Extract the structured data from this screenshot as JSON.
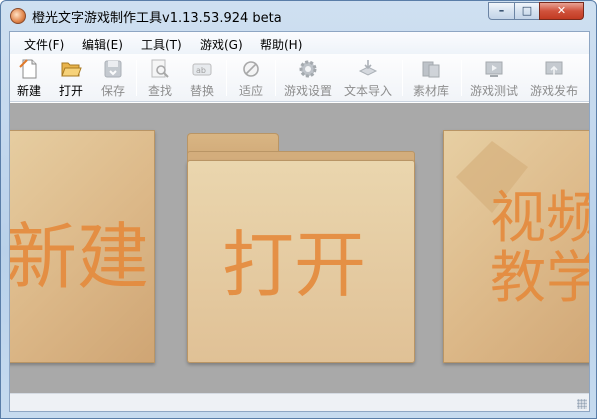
{
  "window": {
    "title": "橙光文字游戏制作工具v1.13.53.924 beta",
    "controls": {
      "minimize": "–",
      "maximize": "□",
      "close": "✕"
    }
  },
  "menu": [
    {
      "label": "文件(F)"
    },
    {
      "label": "编辑(E)"
    },
    {
      "label": "工具(T)"
    },
    {
      "label": "游戏(G)"
    },
    {
      "label": "帮助(H)"
    }
  ],
  "toolbar": [
    {
      "label": "新建",
      "icon": "new-file-icon",
      "enabled": true
    },
    {
      "label": "打开",
      "icon": "folder-open-icon",
      "enabled": true
    },
    {
      "label": "保存",
      "icon": "save-icon",
      "enabled": false
    },
    {
      "label": "查找",
      "icon": "find-icon",
      "enabled": false
    },
    {
      "label": "替换",
      "icon": "replace-icon",
      "enabled": false
    },
    {
      "label": "适应",
      "icon": "fit-icon",
      "enabled": false
    },
    {
      "label": "游戏设置",
      "icon": "gear-icon",
      "enabled": false
    },
    {
      "label": "文本导入",
      "icon": "text-import-icon",
      "enabled": false
    },
    {
      "label": "素材库",
      "icon": "library-icon",
      "enabled": false
    },
    {
      "label": "游戏测试",
      "icon": "test-icon",
      "enabled": false
    },
    {
      "label": "游戏发布",
      "icon": "publish-icon",
      "enabled": false
    }
  ],
  "cards": {
    "new": {
      "text": "新建"
    },
    "open": {
      "text": "打开"
    },
    "video": {
      "line1": "视频",
      "line2": "教学"
    }
  },
  "colors": {
    "workspace_bg": "#a9a9a9",
    "card_text": "#e58a3c",
    "card_bg": "#dcb888"
  }
}
